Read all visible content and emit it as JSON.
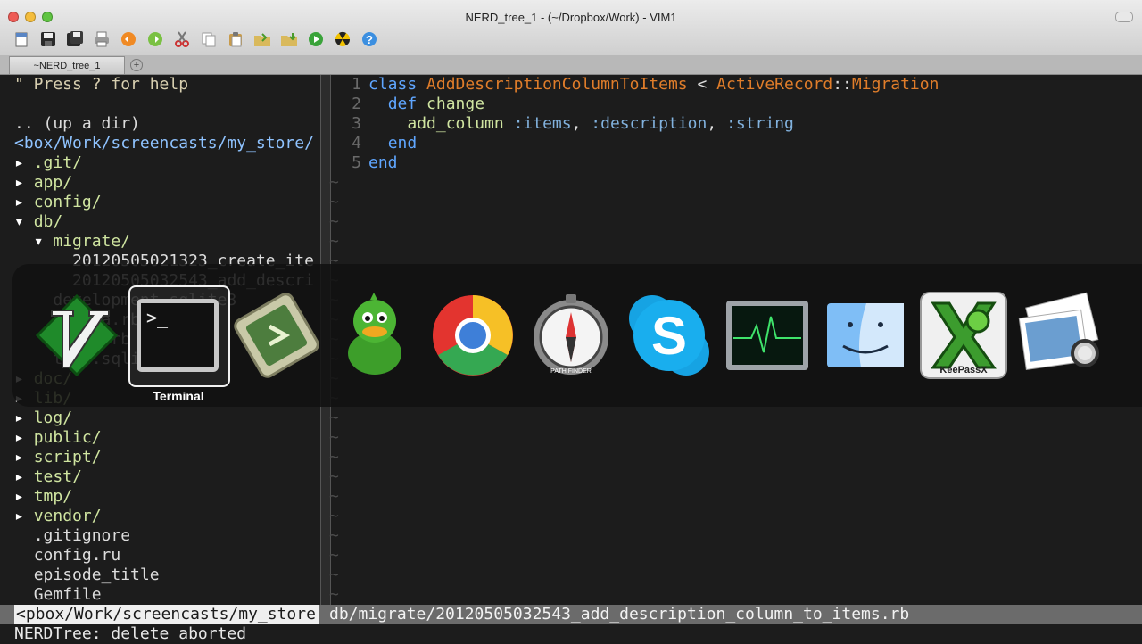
{
  "window": {
    "title": "NERD_tree_1 - (~/Dropbox/Work) - VIM1"
  },
  "toolbar": {
    "icons": [
      "open-icon",
      "save-icon",
      "save-all-icon",
      "print-icon",
      "undo-icon",
      "redo-icon",
      "cut-icon",
      "copy-icon",
      "paste-icon",
      "load-session-icon",
      "save-session-icon",
      "run-icon",
      "build-icon",
      "help-icon"
    ]
  },
  "tabs": [
    {
      "label": "~NERD_tree_1"
    }
  ],
  "nerdtree": {
    "help": "\" Press ? for help",
    "updir": ".. (up a dir)",
    "root": "<box/Work/screencasts/my_store/",
    "entries": [
      {
        "arrow": "▸",
        "indent": "",
        "name": ".git/"
      },
      {
        "arrow": "▸",
        "indent": "",
        "name": "app/"
      },
      {
        "arrow": "▸",
        "indent": "",
        "name": "config/"
      },
      {
        "arrow": "▾",
        "indent": "",
        "name": "db/"
      },
      {
        "arrow": "▾",
        "indent": "  ",
        "name": "migrate/"
      },
      {
        "arrow": " ",
        "indent": "    ",
        "name": "20120505021323_create_ite"
      },
      {
        "arrow": " ",
        "indent": "    ",
        "name": "20120505032543_add_descri"
      },
      {
        "arrow": " ",
        "indent": "  ",
        "name": "development.sqlite3"
      },
      {
        "arrow": " ",
        "indent": "  ",
        "name": "schema.rb"
      },
      {
        "arrow": " ",
        "indent": "  ",
        "name": "seeds.rb"
      },
      {
        "arrow": " ",
        "indent": "  ",
        "name": "test.sqlite3"
      },
      {
        "arrow": "▸",
        "indent": "",
        "name": "doc/"
      },
      {
        "arrow": "▸",
        "indent": "",
        "name": "lib/"
      },
      {
        "arrow": "▸",
        "indent": "",
        "name": "log/"
      },
      {
        "arrow": "▸",
        "indent": "",
        "name": "public/"
      },
      {
        "arrow": "▸",
        "indent": "",
        "name": "script/"
      },
      {
        "arrow": "▸",
        "indent": "",
        "name": "test/"
      },
      {
        "arrow": "▸",
        "indent": "",
        "name": "tmp/"
      },
      {
        "arrow": "▸",
        "indent": "",
        "name": "vendor/"
      },
      {
        "arrow": " ",
        "indent": "",
        "name": ".gitignore"
      },
      {
        "arrow": " ",
        "indent": "",
        "name": "config.ru"
      },
      {
        "arrow": " ",
        "indent": "",
        "name": "episode_title"
      },
      {
        "arrow": " ",
        "indent": "",
        "name": "Gemfile"
      }
    ]
  },
  "code": {
    "lines": [
      {
        "n": "1",
        "parts": [
          [
            "kw",
            "class "
          ],
          [
            "cls",
            "AddDescriptionColumnToItems"
          ],
          [
            "plain",
            " < "
          ],
          [
            "cls",
            "ActiveRecord"
          ],
          [
            "plain",
            "::"
          ],
          [
            "cls",
            "Migration"
          ]
        ]
      },
      {
        "n": "2",
        "parts": [
          [
            "plain",
            "  "
          ],
          [
            "kw",
            "def "
          ],
          [
            "def",
            "change"
          ]
        ]
      },
      {
        "n": "3",
        "parts": [
          [
            "plain",
            "    "
          ],
          [
            "def",
            "add_column "
          ],
          [
            "sym",
            ":items"
          ],
          [
            "plain",
            ", "
          ],
          [
            "sym",
            ":description"
          ],
          [
            "plain",
            ", "
          ],
          [
            "sym",
            ":string"
          ]
        ]
      },
      {
        "n": "4",
        "parts": [
          [
            "plain",
            "  "
          ],
          [
            "kw",
            "end"
          ]
        ]
      },
      {
        "n": "5",
        "parts": [
          [
            "kw",
            "end"
          ]
        ]
      }
    ],
    "tilde": "~"
  },
  "statusline": {
    "left": "<pbox/Work/screencasts/my_store",
    "right": "db/migrate/20120505032543_add_description_column_to_items.rb"
  },
  "cmdline": "NERDTree: delete aborted",
  "app_switcher": {
    "apps": [
      {
        "name": "MacVim",
        "icon": "vim-icon"
      },
      {
        "name": "Terminal",
        "icon": "terminal-icon",
        "selected": true
      },
      {
        "name": "Screenflow",
        "icon": "screenflow-icon"
      },
      {
        "name": "Adium",
        "icon": "adium-duck-icon"
      },
      {
        "name": "Chrome",
        "icon": "chrome-icon"
      },
      {
        "name": "Path Finder",
        "icon": "path-finder-icon"
      },
      {
        "name": "Skype",
        "icon": "skype-icon"
      },
      {
        "name": "Activity Monitor",
        "icon": "activity-monitor-icon"
      },
      {
        "name": "Finder",
        "icon": "finder-icon"
      },
      {
        "name": "KeePassX",
        "icon": "keepassx-icon"
      },
      {
        "name": "Preview",
        "icon": "preview-icon"
      }
    ],
    "selected_label": "Terminal",
    "keepassx_text": "KeePassX",
    "path_finder_text": "PATH FINDER"
  }
}
